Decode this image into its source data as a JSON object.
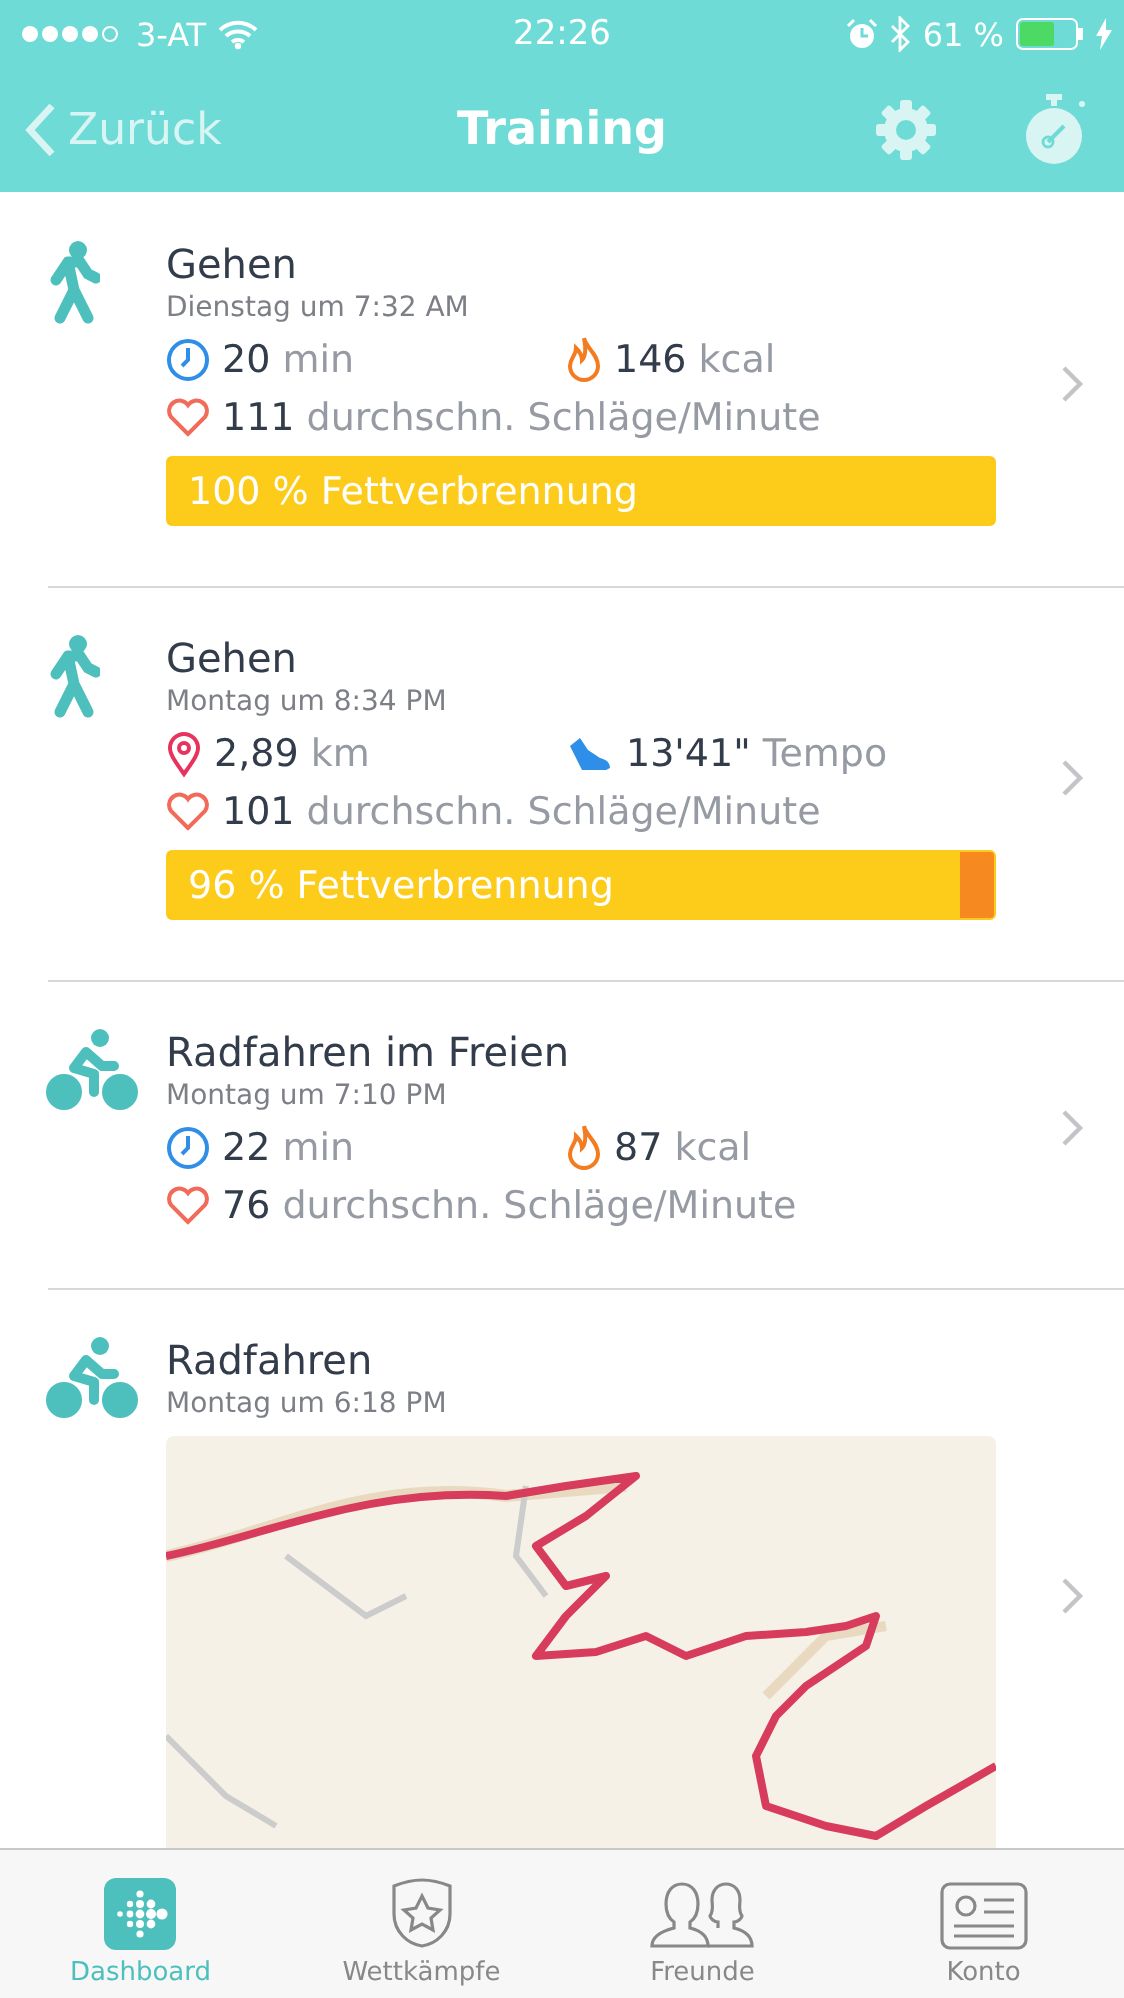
{
  "status_bar": {
    "carrier": "3-AT",
    "time": "22:26",
    "battery": "61 %"
  },
  "nav": {
    "back": "Zurück",
    "title": "Training"
  },
  "activities": [
    {
      "kind": "walk",
      "name": "Gehen",
      "date": "Dienstag um 7:32 AM",
      "stats": [
        {
          "kind": "duration",
          "value": "20",
          "unit": "min"
        },
        {
          "kind": "calories",
          "value": "146",
          "unit": "kcal"
        },
        {
          "kind": "heart",
          "value": "111",
          "unit": "durchschn. Schläge/Minute"
        }
      ],
      "fat_burn": {
        "label": "100 % Fettverbrennung",
        "level": 1
      }
    },
    {
      "kind": "walk",
      "name": "Gehen",
      "date": "Montag um 8:34 PM",
      "stats": [
        {
          "kind": "distance",
          "value": "2,89",
          "unit": "km"
        },
        {
          "kind": "pace",
          "value": "13'41\"",
          "unit": "Tempo"
        },
        {
          "kind": "heart",
          "value": "101",
          "unit": "durchschn. Schläge/Minute"
        }
      ],
      "fat_burn": {
        "label": "96 % Fettverbrennung",
        "level": 0.96
      }
    },
    {
      "kind": "bike",
      "name": "Radfahren im Freien",
      "date": "Montag um 7:10 PM",
      "stats": [
        {
          "kind": "duration",
          "value": "22",
          "unit": "min"
        },
        {
          "kind": "calories",
          "value": "87",
          "unit": "kcal"
        },
        {
          "kind": "heart",
          "value": "76",
          "unit": "durchschn. Schläge/Minute"
        }
      ]
    },
    {
      "kind": "bike",
      "name": "Radfahren",
      "date": "Montag um 6:18 PM"
    }
  ],
  "tabs": [
    {
      "kind": "dashboard",
      "label": "Dashboard",
      "selected": true
    },
    {
      "kind": "challenges",
      "label": "Wettkämpfe",
      "selected": false
    },
    {
      "kind": "friends",
      "label": "Freunde",
      "selected": false
    },
    {
      "kind": "account",
      "label": "Konto",
      "selected": false
    }
  ]
}
